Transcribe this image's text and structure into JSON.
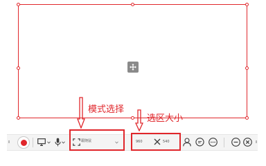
{
  "annotations": {
    "mode_label": "模式选择",
    "size_label": "选区大小"
  },
  "toolbar": {
    "mode_value": "跟随鼠",
    "size_width": "960",
    "size_height": "540",
    "icons": [
      "record-icon",
      "monitor-icon",
      "microphone-icon",
      "fullscreen-icon",
      "link-icon",
      "person-icon",
      "chat-icon",
      "more-icon",
      "minimize-icon",
      "close-icon"
    ]
  },
  "colors": {
    "accent": "#e0262b",
    "toolbar_bg": "#f4f4f4",
    "icon": "#3a3a3a"
  }
}
